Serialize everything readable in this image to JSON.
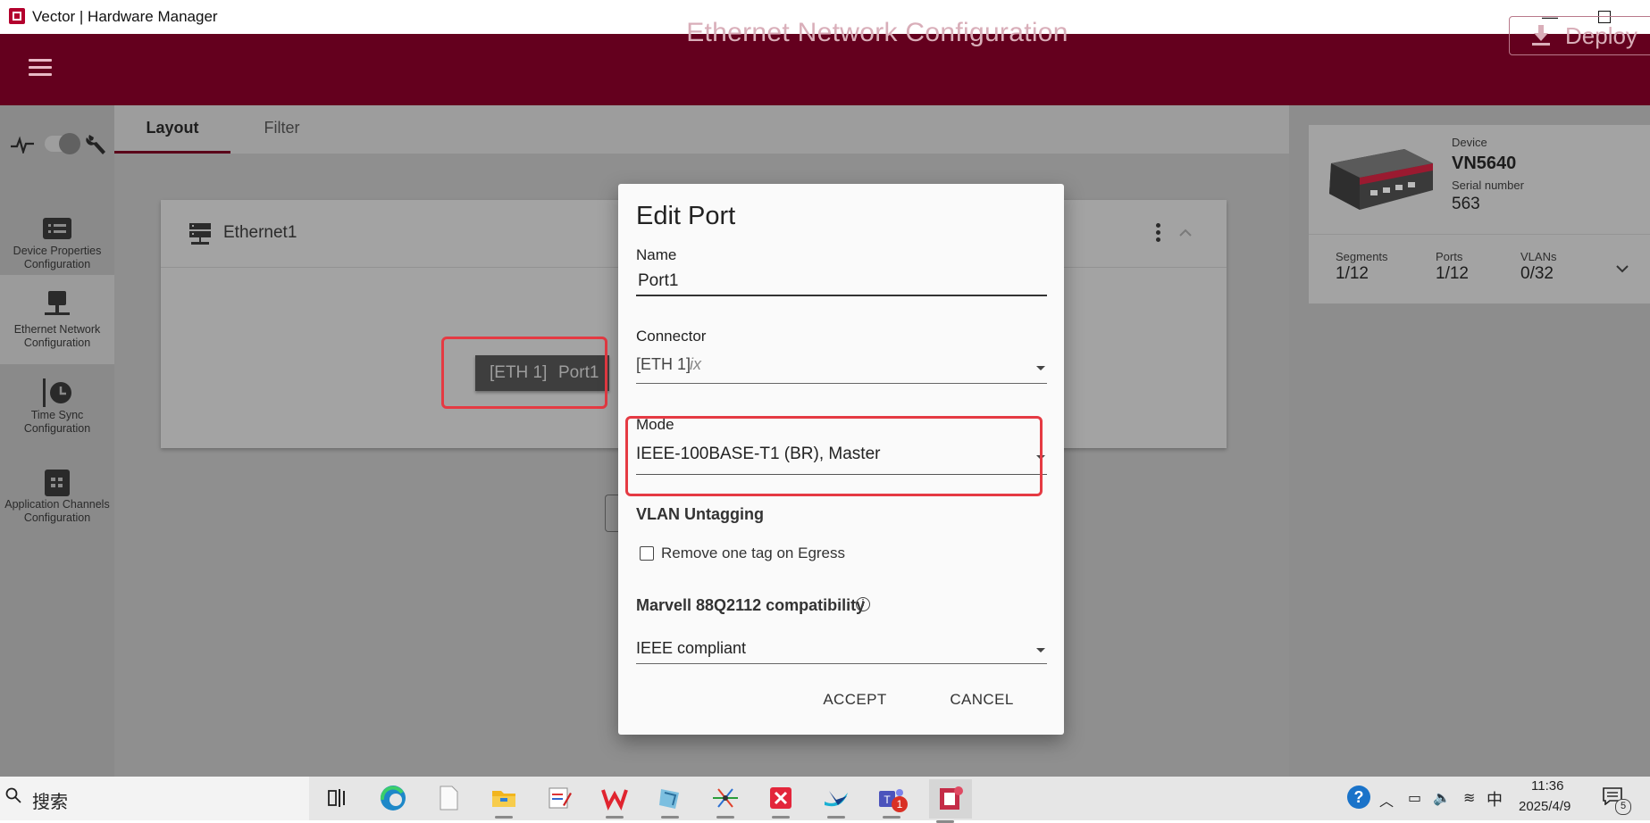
{
  "window": {
    "title": "Vector | Hardware Manager",
    "minimize": "—"
  },
  "header": {
    "title": "Ethernet Network Configuration",
    "deploy_label": "Deploy"
  },
  "sidebar": {
    "items": [
      {
        "label": "Device Properties Configuration",
        "icon": "device-properties-icon"
      },
      {
        "label": "Ethernet Network Configuration",
        "icon": "ethernet-network-icon"
      },
      {
        "label": "Time Sync Configuration",
        "icon": "time-sync-icon"
      },
      {
        "label": "Application Channels Configuration",
        "icon": "app-channels-icon"
      }
    ]
  },
  "tabs": [
    {
      "label": "Layout"
    },
    {
      "label": "Filter"
    }
  ],
  "ethernet_card": {
    "title": "Ethernet1",
    "port_chip": {
      "connector": "[ETH 1]",
      "name": "Port1"
    }
  },
  "device": {
    "label": "Device",
    "name": "VN5640",
    "serial_label": "Serial number",
    "serial_value": "563",
    "stats": [
      {
        "label": "Segments",
        "value": "1/12"
      },
      {
        "label": "Ports",
        "value": "1/12"
      },
      {
        "label": "VLANs",
        "value": "0/32"
      }
    ]
  },
  "dialog": {
    "title": "Edit Port",
    "name_label": "Name",
    "name_value": "Port1",
    "connector_label": "Connector",
    "connector_value": "[ETH 1]",
    "connector_hint": "ix",
    "mode_label": "Mode",
    "mode_value": "IEEE-100BASE-T1 (BR), Master",
    "vlan_heading": "VLAN Untagging",
    "egress_label": "Remove one tag on Egress",
    "egress_checked": false,
    "marvell_label": "Marvell 88Q2112 compatibility",
    "marvell_value": "IEEE compliant",
    "accept_label": "ACCEPT",
    "cancel_label": "CANCEL"
  },
  "taskbar": {
    "search_text": "搜索",
    "apps": [
      "task-view-icon",
      "edge-icon",
      "notepad-icon",
      "file-explorer-icon",
      "editor-icon",
      "wps-icon",
      "vm-icon",
      "network-tool-icon",
      "xmind-icon",
      "feishu-icon",
      "teams-icon",
      "hardware-manager-icon"
    ],
    "teams_badge": "1",
    "ime": "中",
    "time": "11:36",
    "date": "2025/4/9",
    "notification_count": "5"
  },
  "colors": {
    "brand": "#64001e",
    "highlight": "#e53a43",
    "accent": "#5a0019"
  }
}
